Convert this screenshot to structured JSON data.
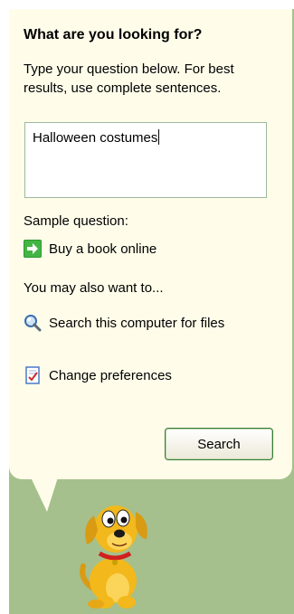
{
  "panel": {
    "title": "What are you looking for?",
    "instructions": "Type your question below. For best results, use complete sentences.",
    "query_value": "Halloween costumes",
    "sample_label": "Sample question:",
    "sample_question": "Buy a book online",
    "also_label": "You may also want to...",
    "also_items": [
      {
        "label": "Search this computer for files",
        "icon": "magnifier-icon"
      },
      {
        "label": "Change preferences",
        "icon": "preferences-icon"
      }
    ],
    "search_button_label": "Search"
  },
  "companion": {
    "character": "animated-dog"
  },
  "colors": {
    "bubble_bg": "#fffdea",
    "backdrop": "#a5c08c",
    "arrow_green": "#2e9a2e",
    "button_border": "#3a7a3a"
  }
}
